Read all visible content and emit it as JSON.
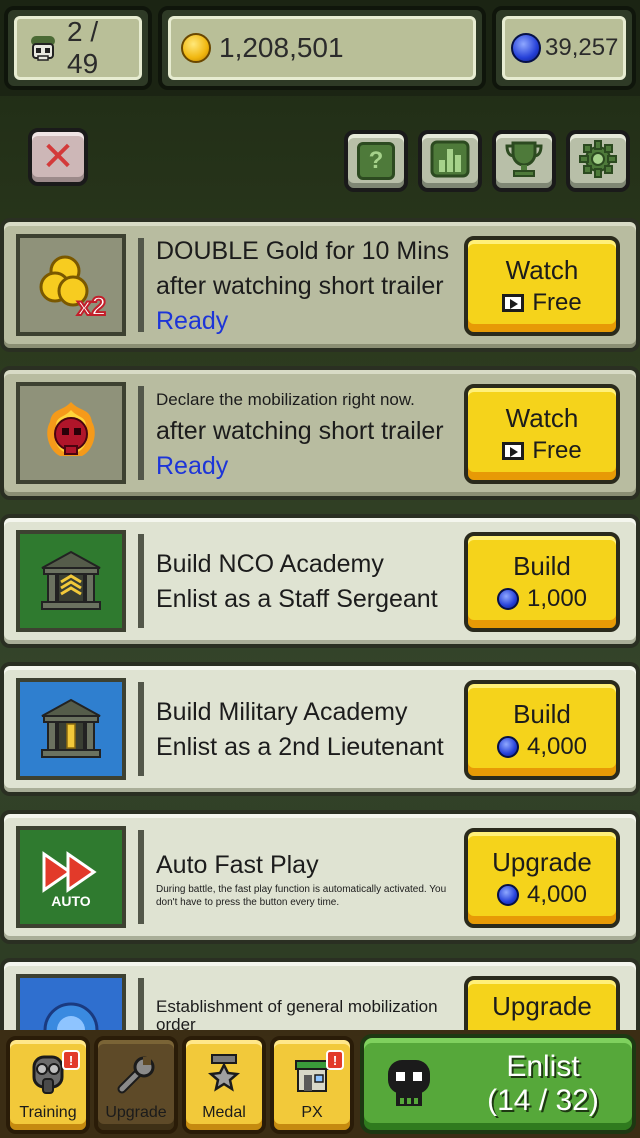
{
  "topbar": {
    "army": {
      "icon": "skull-helmet-icon",
      "value": "2 / 49"
    },
    "gold": {
      "icon": "gold-coin-icon",
      "value": "1,208,501"
    },
    "gems": {
      "icon": "blue-gem-icon",
      "value": "39,257"
    }
  },
  "toolbar": {
    "close_icon": "close-icon",
    "help_icon": "help-card-icon",
    "ranking_icon": "ranking-chart-icon",
    "trophy_icon": "trophy-icon",
    "settings_icon": "gear-icon"
  },
  "rows": [
    {
      "id": "double-gold",
      "icon": "gold-coins-x2-icon",
      "icon_label": "x2",
      "line1": "DOUBLE Gold for 10 Mins",
      "line2": "after watching short trailer",
      "status": "Ready",
      "action_title": "Watch",
      "action_sub": "Free"
    },
    {
      "id": "mobilization",
      "icon": "flaming-skull-icon",
      "line1": "Declare the mobilization right now.",
      "line2": "after watching short trailer",
      "status": "Ready",
      "action_title": "Watch",
      "action_sub": "Free"
    },
    {
      "id": "nco-academy",
      "icon": "nco-academy-icon",
      "line1": "Build NCO Academy",
      "line2": "Enlist as a Staff Sergeant",
      "action_title": "Build",
      "action_cost": "1,000"
    },
    {
      "id": "military-academy",
      "icon": "military-academy-icon",
      "line1": "Build Military Academy",
      "line2": "Enlist as a 2nd Lieutenant",
      "action_title": "Build",
      "action_cost": "4,000"
    },
    {
      "id": "auto-fast-play",
      "icon": "auto-fast-forward-icon",
      "icon_label": "AUTO",
      "line1": "Auto Fast Play",
      "line2": "During battle, the fast play function is automatically activated. You don't have to press the button every time.",
      "action_title": "Upgrade",
      "action_cost": "4,000"
    },
    {
      "id": "general-mobilization",
      "icon": "blue-badge-icon",
      "line1": "Establishment of general mobilization order",
      "action_title": "Upgrade"
    }
  ],
  "nav": {
    "training": {
      "label": "Training",
      "icon": "gas-mask-icon",
      "alert": "!"
    },
    "upgrade": {
      "label": "Upgrade",
      "icon": "wrench-icon"
    },
    "medal": {
      "label": "Medal",
      "icon": "medal-icon"
    },
    "px": {
      "label": "PX",
      "icon": "shop-icon",
      "alert": "!"
    },
    "enlist": {
      "title": "Enlist",
      "count": "(14 / 32)",
      "icon": "skull-icon"
    }
  },
  "colors": {
    "action_yellow": "#f5d31b",
    "ready_blue": "#1d35d8",
    "enlist_green": "#56a83a",
    "nav_gold": "#f2c93a"
  }
}
